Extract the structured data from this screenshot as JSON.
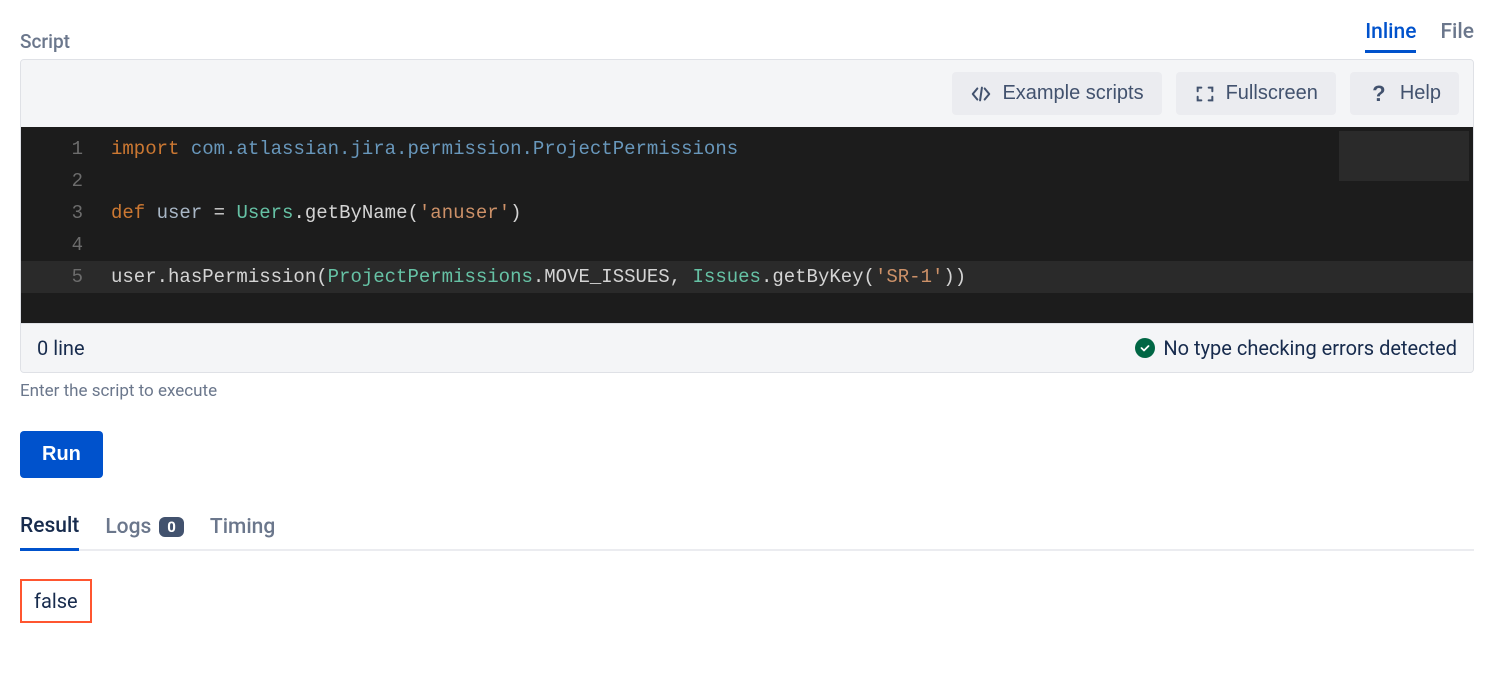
{
  "header": {
    "section_label": "Script",
    "view_tabs": {
      "inline": "Inline",
      "file": "File"
    }
  },
  "toolbar": {
    "example": "Example scripts",
    "fullscreen": "Fullscreen",
    "help": "Help"
  },
  "code": {
    "line_numbers": [
      "1",
      "2",
      "3",
      "4",
      "5"
    ],
    "l1_kw": "import",
    "l1_sp1": " ",
    "l1_pkg": "com.atlassian.jira.permission.ProjectPermissions",
    "l3_kw": "def",
    "l3_sp1": " ",
    "l3_var": "user",
    "l3_sp2": " ",
    "l3_eq": "= ",
    "l3_cls": "Users",
    "l3_call": ".getByName(",
    "l3_str": "'anuser'",
    "l3_close": ")",
    "l5_pre": "user.hasPermission(",
    "l5_t1": "ProjectPermissions",
    "l5_m1": ".MOVE_ISSUES, ",
    "l5_t2": "Issues",
    "l5_m2": ".getByKey(",
    "l5_str": "'SR-1'",
    "l5_close": "))"
  },
  "status": {
    "left": "0 line",
    "right": "No type checking errors detected"
  },
  "helper": "Enter the script to execute",
  "run": "Run",
  "result_tabs": {
    "result": "Result",
    "logs": "Logs",
    "logs_count": "0",
    "timing": "Timing"
  },
  "result_value": "false"
}
